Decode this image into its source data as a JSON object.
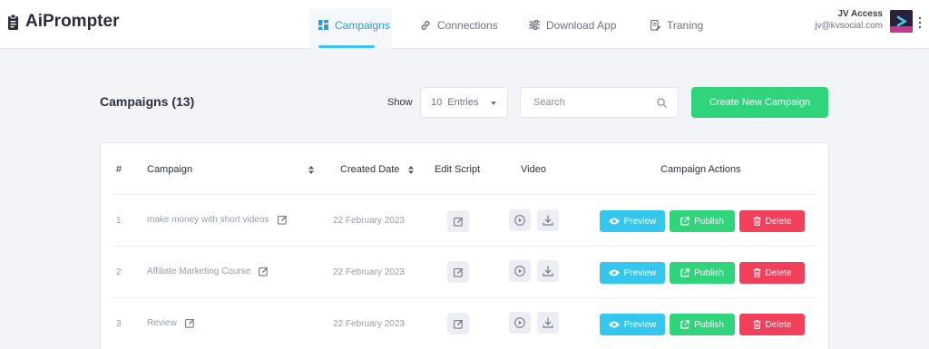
{
  "app": {
    "title": "AiPrompter"
  },
  "nav": {
    "tabs": [
      {
        "label": "Campaigns",
        "icon": "grid-icon",
        "active": true
      },
      {
        "label": "Connections",
        "icon": "link-icon",
        "active": false
      },
      {
        "label": "Download App",
        "icon": "sliders-icon",
        "active": false
      },
      {
        "label": "Traning",
        "icon": "document-edit-icon",
        "active": false
      }
    ]
  },
  "user": {
    "name": "JV Access",
    "email": "jv@kvsocial.com"
  },
  "toolbar": {
    "title": "Campaigns (13)",
    "show_label": "Show",
    "entries_value": "10",
    "entries_label": "Entries",
    "search_placeholder": "Search",
    "create_label": "Create New Campaign"
  },
  "table": {
    "columns": [
      "#",
      "Campaign",
      "Created Date",
      "Edit Script",
      "Video",
      "Campaign Actions"
    ],
    "rows": [
      {
        "index": "1",
        "campaign": "make money with short videos",
        "created": "22 February 2023"
      },
      {
        "index": "2",
        "campaign": "Affiliate Marketing Course",
        "created": "22 February 2023"
      },
      {
        "index": "3",
        "campaign": "Review",
        "created": "22 February 2023"
      }
    ],
    "actions": {
      "preview": "Preview",
      "publish": "Publish",
      "delete": "Delete"
    }
  },
  "colors": {
    "accent": "#35c7f0",
    "create_button": "#2fd47b",
    "preview": "#33c7ee",
    "publish": "#2fd47b",
    "delete": "#f2405b"
  }
}
